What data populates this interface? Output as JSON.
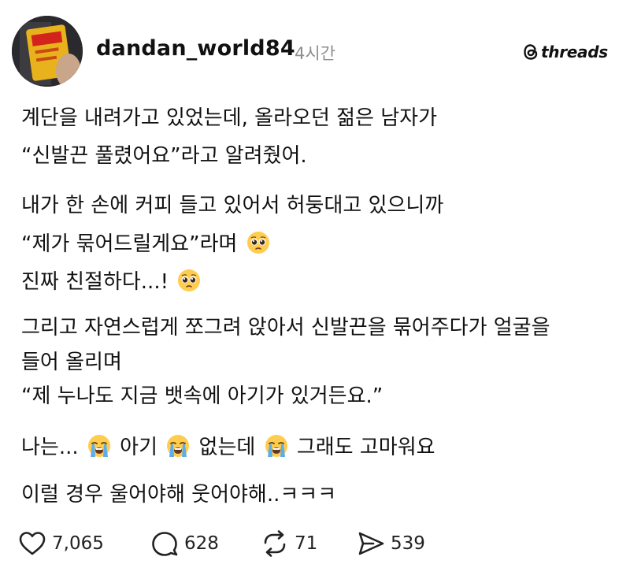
{
  "post": {
    "username": "dandan_world84",
    "time": "4시간",
    "brand": "threads",
    "lines": {
      "l1": "계단을 내려가고 있었는데, 올라오던 젊은 남자가",
      "l2": "“신발끈 풀렸어요”라고 알려줬어.",
      "l3": "내가 한 손에 커피 들고 있어서 허둥대고 있으니까",
      "l4": "“제가 묶어드릴게요”라며",
      "l5": "진짜 친절하다...!",
      "l6": "그리고 자연스럽게 쪼그려 앉아서 신발끈을 묶어주다가 얼굴을",
      "l7": "들어 올리며",
      "l8": "“제 누나도 지금 뱃속에 아기가 있거든요.”",
      "l9a": "나는...",
      "l9b": "아기",
      "l9c": "없는데",
      "l9d": "그래도 고마워요",
      "l10": "이럴 경우 울어야해 웃어야해..ㅋㅋㅋ"
    },
    "stats": {
      "likes": "7,065",
      "comments": "628",
      "reposts": "71",
      "shares": "539"
    },
    "icons": {
      "avatar": "avatar-snack-box",
      "brand_logo": "threads-logo-icon",
      "pleading_emoji": "pleading-face-emoji",
      "crying_emoji": "loudly-crying-face-emoji",
      "like": "heart-icon",
      "comment": "comment-bubble-icon",
      "repost": "repost-icon",
      "share": "send-icon"
    }
  }
}
